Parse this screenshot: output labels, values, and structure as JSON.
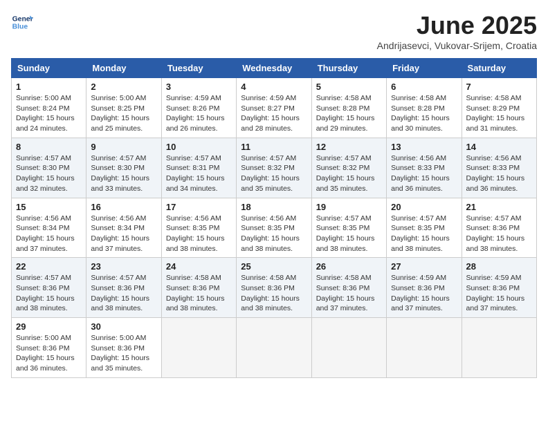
{
  "logo": {
    "line1": "General",
    "line2": "Blue"
  },
  "title": "June 2025",
  "subtitle": "Andrijasevci, Vukovar-Srijem, Croatia",
  "weekdays": [
    "Sunday",
    "Monday",
    "Tuesday",
    "Wednesday",
    "Thursday",
    "Friday",
    "Saturday"
  ],
  "weeks": [
    [
      {
        "day": "1",
        "info": "Sunrise: 5:00 AM\nSunset: 8:24 PM\nDaylight: 15 hours\nand 24 minutes."
      },
      {
        "day": "2",
        "info": "Sunrise: 5:00 AM\nSunset: 8:25 PM\nDaylight: 15 hours\nand 25 minutes."
      },
      {
        "day": "3",
        "info": "Sunrise: 4:59 AM\nSunset: 8:26 PM\nDaylight: 15 hours\nand 26 minutes."
      },
      {
        "day": "4",
        "info": "Sunrise: 4:59 AM\nSunset: 8:27 PM\nDaylight: 15 hours\nand 28 minutes."
      },
      {
        "day": "5",
        "info": "Sunrise: 4:58 AM\nSunset: 8:28 PM\nDaylight: 15 hours\nand 29 minutes."
      },
      {
        "day": "6",
        "info": "Sunrise: 4:58 AM\nSunset: 8:28 PM\nDaylight: 15 hours\nand 30 minutes."
      },
      {
        "day": "7",
        "info": "Sunrise: 4:58 AM\nSunset: 8:29 PM\nDaylight: 15 hours\nand 31 minutes."
      }
    ],
    [
      {
        "day": "8",
        "info": "Sunrise: 4:57 AM\nSunset: 8:30 PM\nDaylight: 15 hours\nand 32 minutes."
      },
      {
        "day": "9",
        "info": "Sunrise: 4:57 AM\nSunset: 8:30 PM\nDaylight: 15 hours\nand 33 minutes."
      },
      {
        "day": "10",
        "info": "Sunrise: 4:57 AM\nSunset: 8:31 PM\nDaylight: 15 hours\nand 34 minutes."
      },
      {
        "day": "11",
        "info": "Sunrise: 4:57 AM\nSunset: 8:32 PM\nDaylight: 15 hours\nand 35 minutes."
      },
      {
        "day": "12",
        "info": "Sunrise: 4:57 AM\nSunset: 8:32 PM\nDaylight: 15 hours\nand 35 minutes."
      },
      {
        "day": "13",
        "info": "Sunrise: 4:56 AM\nSunset: 8:33 PM\nDaylight: 15 hours\nand 36 minutes."
      },
      {
        "day": "14",
        "info": "Sunrise: 4:56 AM\nSunset: 8:33 PM\nDaylight: 15 hours\nand 36 minutes."
      }
    ],
    [
      {
        "day": "15",
        "info": "Sunrise: 4:56 AM\nSunset: 8:34 PM\nDaylight: 15 hours\nand 37 minutes."
      },
      {
        "day": "16",
        "info": "Sunrise: 4:56 AM\nSunset: 8:34 PM\nDaylight: 15 hours\nand 37 minutes."
      },
      {
        "day": "17",
        "info": "Sunrise: 4:56 AM\nSunset: 8:35 PM\nDaylight: 15 hours\nand 38 minutes."
      },
      {
        "day": "18",
        "info": "Sunrise: 4:56 AM\nSunset: 8:35 PM\nDaylight: 15 hours\nand 38 minutes."
      },
      {
        "day": "19",
        "info": "Sunrise: 4:57 AM\nSunset: 8:35 PM\nDaylight: 15 hours\nand 38 minutes."
      },
      {
        "day": "20",
        "info": "Sunrise: 4:57 AM\nSunset: 8:35 PM\nDaylight: 15 hours\nand 38 minutes."
      },
      {
        "day": "21",
        "info": "Sunrise: 4:57 AM\nSunset: 8:36 PM\nDaylight: 15 hours\nand 38 minutes."
      }
    ],
    [
      {
        "day": "22",
        "info": "Sunrise: 4:57 AM\nSunset: 8:36 PM\nDaylight: 15 hours\nand 38 minutes."
      },
      {
        "day": "23",
        "info": "Sunrise: 4:57 AM\nSunset: 8:36 PM\nDaylight: 15 hours\nand 38 minutes."
      },
      {
        "day": "24",
        "info": "Sunrise: 4:58 AM\nSunset: 8:36 PM\nDaylight: 15 hours\nand 38 minutes."
      },
      {
        "day": "25",
        "info": "Sunrise: 4:58 AM\nSunset: 8:36 PM\nDaylight: 15 hours\nand 38 minutes."
      },
      {
        "day": "26",
        "info": "Sunrise: 4:58 AM\nSunset: 8:36 PM\nDaylight: 15 hours\nand 37 minutes."
      },
      {
        "day": "27",
        "info": "Sunrise: 4:59 AM\nSunset: 8:36 PM\nDaylight: 15 hours\nand 37 minutes."
      },
      {
        "day": "28",
        "info": "Sunrise: 4:59 AM\nSunset: 8:36 PM\nDaylight: 15 hours\nand 37 minutes."
      }
    ],
    [
      {
        "day": "29",
        "info": "Sunrise: 5:00 AM\nSunset: 8:36 PM\nDaylight: 15 hours\nand 36 minutes."
      },
      {
        "day": "30",
        "info": "Sunrise: 5:00 AM\nSunset: 8:36 PM\nDaylight: 15 hours\nand 35 minutes."
      },
      {
        "day": "",
        "info": ""
      },
      {
        "day": "",
        "info": ""
      },
      {
        "day": "",
        "info": ""
      },
      {
        "day": "",
        "info": ""
      },
      {
        "day": "",
        "info": ""
      }
    ]
  ]
}
